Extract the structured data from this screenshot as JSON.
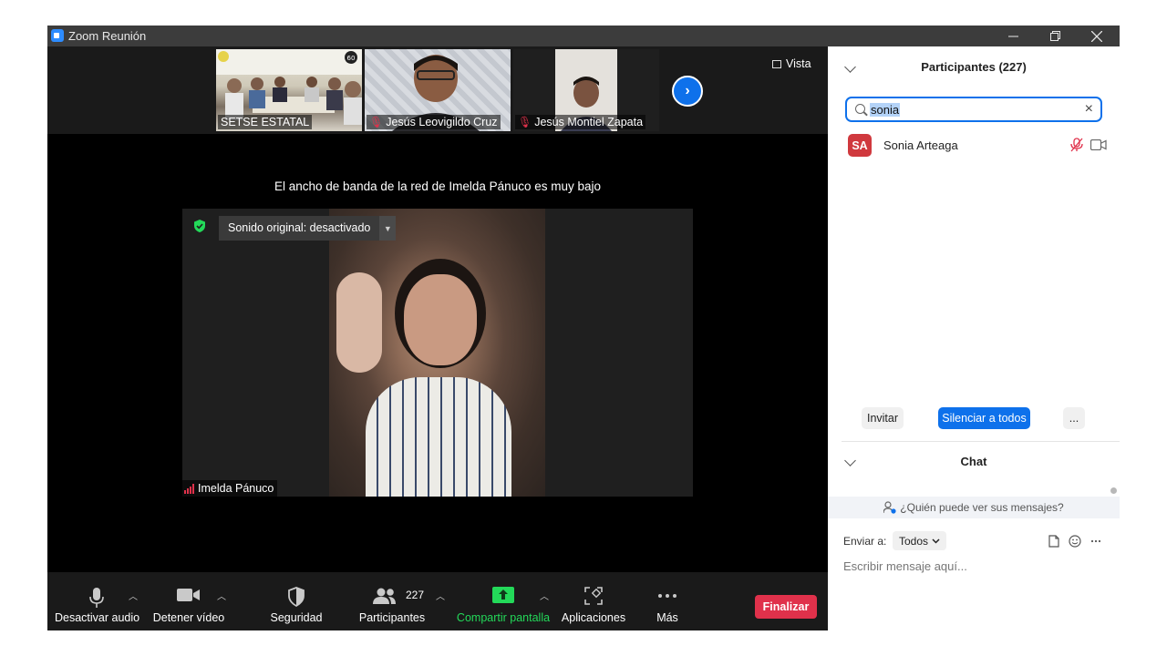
{
  "window": {
    "title": "Zoom Reunión"
  },
  "thumbnails": [
    {
      "label": "SETSE ESTATAL",
      "muted": false
    },
    {
      "label": "Jesús Leovigildo Cruz",
      "muted": true
    },
    {
      "label": "Jesús Montiel Zapata",
      "muted": true
    }
  ],
  "view_label": "Vista",
  "bandwidth_message": "El ancho de banda de la red de Imelda Pánuco es muy bajo",
  "original_sound": "Sonido original: desactivado",
  "active_speaker": "Imelda Pánuco",
  "toolbar": {
    "audio": "Desactivar audio",
    "video": "Detener vídeo",
    "security": "Seguridad",
    "participants": "Participantes",
    "participants_count": "227",
    "share": "Compartir pantalla",
    "apps": "Aplicaciones",
    "more": "Más",
    "end": "Finalizar"
  },
  "participants_panel": {
    "title": "Participantes (227)",
    "search_value": "sonia",
    "results": [
      {
        "initials": "SA",
        "name": "Sonia Arteaga"
      }
    ],
    "invite": "Invitar",
    "mute_all": "Silenciar a todos",
    "more": "..."
  },
  "chat_panel": {
    "title": "Chat",
    "who_can_see": "¿Quién puede ver sus mensajes?",
    "send_to_label": "Enviar a:",
    "send_to_value": "Todos",
    "placeholder": "Escribir mensaje aquí..."
  },
  "colors": {
    "accent": "#0e71eb",
    "danger": "#e0314b",
    "share_green": "#23d959",
    "toolbar_bg": "#1a1a1a"
  }
}
